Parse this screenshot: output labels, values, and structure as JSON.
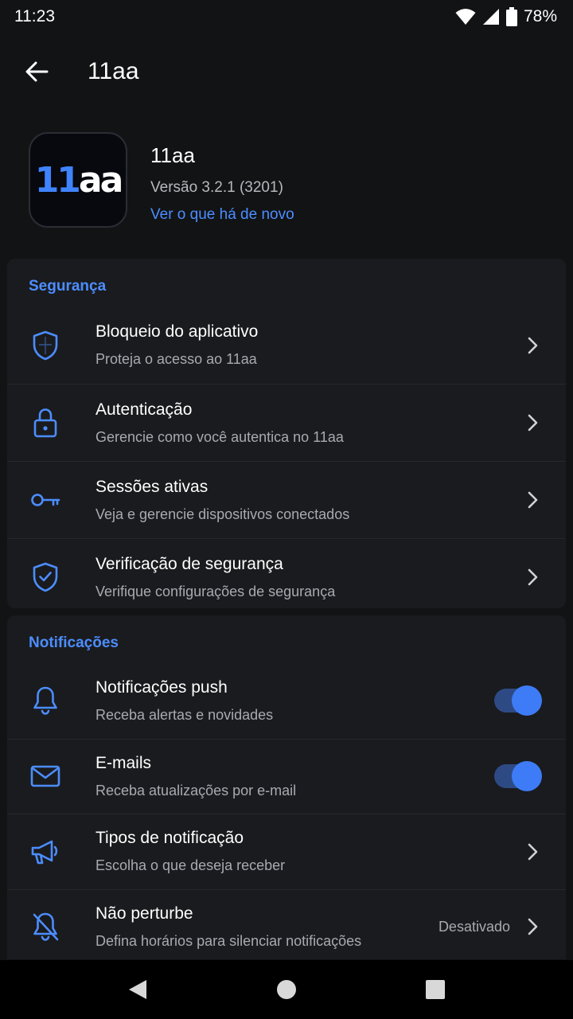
{
  "status_bar": {
    "time": "11:23",
    "battery": "78%"
  },
  "app_bar": {
    "title": "11aa",
    "back_icon": "arrow-left-icon"
  },
  "app_info": {
    "logo_part1": "11",
    "logo_part2": "aa",
    "name": "11aa",
    "version": "Versão 3.2.1 (3201)",
    "whats_new": "Ver o que há de novo"
  },
  "security": {
    "title": "Segurança",
    "items": [
      {
        "icon": "shield-icon",
        "title": "Bloqueio do aplicativo",
        "subtitle": "Proteja o acesso ao 11aa"
      },
      {
        "icon": "lock-icon",
        "title": "Autenticação",
        "subtitle": "Gerencie como você autentica no 11aa"
      },
      {
        "icon": "key-icon",
        "title": "Sessões ativas",
        "subtitle": "Veja e gerencie dispositivos conectados"
      },
      {
        "icon": "shield-check-icon",
        "title": "Verificação de segurança",
        "subtitle": "Verifique configurações de segurança"
      }
    ]
  },
  "notifications": {
    "title": "Notificações",
    "items": [
      {
        "icon": "bell-icon",
        "title": "Notificações push",
        "subtitle": "Receba alertas e novidades",
        "toggle_on": true
      },
      {
        "icon": "mail-icon",
        "title": "E-mails",
        "subtitle": "Receba atualizações por e-mail",
        "toggle_on": true
      },
      {
        "icon": "megaphone-icon",
        "title": "Tipos de notificação",
        "subtitle": "Escolha o que deseja receber"
      },
      {
        "icon": "bell-off-icon",
        "title": "Não perturbe",
        "subtitle": "Defina horários para silenciar notificações",
        "value": "Desativado"
      }
    ]
  },
  "colors": {
    "accent": "#4c8dff",
    "background": "#121315",
    "card": "#1a1b1e"
  }
}
